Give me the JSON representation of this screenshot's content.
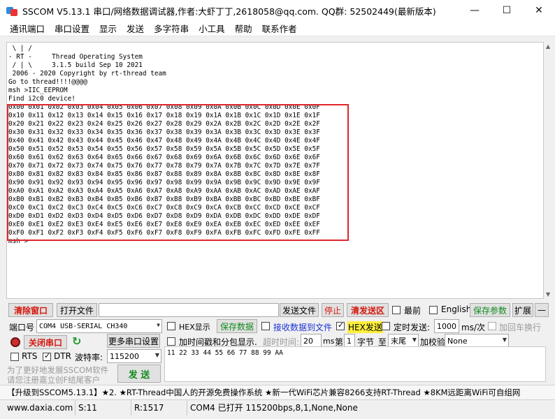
{
  "window": {
    "title": "SSCOM V5.13.1 串口/网络数据调试器,作者:大虾丁丁,2618058@qq.com. QQ群: 52502449(最新版本)",
    "controls": {
      "minimize": "—",
      "maximize": "☐",
      "close": "✕"
    }
  },
  "menu": [
    "通讯端口",
    "串口设置",
    "显示",
    "发送",
    "多字符串",
    "小工具",
    "帮助",
    "联系作者"
  ],
  "terminal": {
    "lines": [
      " \\ | /",
      "- RT -     Thread Operating System",
      " / | \\     3.1.5 build Sep 10 2021",
      " 2006 - 2020 Copyright by rt-thread team",
      "Go to thread!!!!@@@@",
      "msh >IIC_EEPROM",
      "Find i2c0 device!",
      "0x00 0x01 0x02 0x03 0x04 0x05 0x06 0x07 0x08 0x09 0x0A 0x0B 0x0C 0x0D 0x0E 0x0F",
      "0x10 0x11 0x12 0x13 0x14 0x15 0x16 0x17 0x18 0x19 0x1A 0x1B 0x1C 0x1D 0x1E 0x1F",
      "0x20 0x21 0x22 0x23 0x24 0x25 0x26 0x27 0x28 0x29 0x2A 0x2B 0x2C 0x2D 0x2E 0x2F",
      "0x30 0x31 0x32 0x33 0x34 0x35 0x36 0x37 0x38 0x39 0x3A 0x3B 0x3C 0x3D 0x3E 0x3F",
      "0x40 0x41 0x42 0x43 0x44 0x45 0x46 0x47 0x48 0x49 0x4A 0x4B 0x4C 0x4D 0x4E 0x4F",
      "0x50 0x51 0x52 0x53 0x54 0x55 0x56 0x57 0x58 0x59 0x5A 0x5B 0x5C 0x5D 0x5E 0x5F",
      "0x60 0x61 0x62 0x63 0x64 0x65 0x66 0x67 0x68 0x69 0x6A 0x6B 0x6C 0x6D 0x6E 0x6F",
      "0x70 0x71 0x72 0x73 0x74 0x75 0x76 0x77 0x78 0x79 0x7A 0x7B 0x7C 0x7D 0x7E 0x7F",
      "0x80 0x81 0x82 0x83 0x84 0x85 0x86 0x87 0x88 0x89 0x8A 0x8B 0x8C 0x8D 0x8E 0x8F",
      "0x90 0x91 0x92 0x93 0x94 0x95 0x96 0x97 0x98 0x99 0x9A 0x9B 0x9C 0x9D 0x9E 0x9F",
      "0xA0 0xA1 0xA2 0xA3 0xA4 0xA5 0xA6 0xA7 0xA8 0xA9 0xAA 0xAB 0xAC 0xAD 0xAE 0xAF",
      "0xB0 0xB1 0xB2 0xB3 0xB4 0xB5 0xB6 0xB7 0xB8 0xB9 0xBA 0xBB 0xBC 0xBD 0xBE 0xBF",
      "0xC0 0xC1 0xC2 0xC3 0xC4 0xC5 0xC6 0xC7 0xC8 0xC9 0xCA 0xCB 0xCC 0xCD 0xCE 0xCF",
      "0xD0 0xD1 0xD2 0xD3 0xD4 0xD5 0xD6 0xD7 0xD8 0xD9 0xDA 0xDB 0xDC 0xDD 0xDE 0xDF",
      "0xE0 0xE1 0xE2 0xE3 0xE4 0xE5 0xE6 0xE7 0xE8 0xE9 0xEA 0xEB 0xEC 0xED 0xEE 0xEF",
      "0xF0 0xF1 0xF2 0xF3 0xF4 0xF5 0xF6 0xF7 0xF8 0xF9 0xFA 0xFB 0xFC 0xFD 0xFE 0xFF",
      "msh >"
    ],
    "highlight_color": "#e0252b"
  },
  "row1": {
    "clear": "清除窗口",
    "open_file": "打开文件",
    "send_file": "发送文件",
    "stop": "停止",
    "clear_send": "清发送区",
    "topmost": "最前",
    "english": "English",
    "save_params": "保存参数",
    "expand": "扩展",
    "collapse": "—"
  },
  "row2": {
    "port_label": "端口号",
    "port_value": "COM4 USB-SERIAL CH340",
    "hex_display": "HEX显示",
    "save_data": "保存数据",
    "recv_to_file": "接收数据到文件",
    "hex_send": "HEX发送",
    "timed_send": "定时发送:",
    "interval": "1000",
    "interval_unit": "ms/次",
    "add_cr": "加回车换行"
  },
  "row3": {
    "close_port": "关闭串口",
    "more_settings": "更多串口设置",
    "timestamp": "加时间戳和分包显示.",
    "timeout_label": "超时时间:",
    "timeout_value": "20",
    "timeout_unit": "ms",
    "nth": "第",
    "byte_start": "1",
    "byte_label": "字节",
    "to": "至",
    "end_value": "末尾",
    "checksum_label": "加校验",
    "checksum_value": "None"
  },
  "row4": {
    "rts": "RTS",
    "dtr": "DTR",
    "baud_label": "波特率:",
    "baud_value": "115200"
  },
  "send": {
    "promo_line1": "为了更好地发展SSCOM软件",
    "promo_line2": "请您注册嘉立创F结尾客户",
    "send_button": "发 送",
    "text": "11 22 33 44 55 66 77 88 99 AA"
  },
  "ticker": "【升级到SSCOM5.13.1】★2. ★RT-Thread中国人的开源免费操作系统 ★新一代WiFi芯片兼容8266支持RT-Thread ★8KM远距离WiFi可自组网",
  "status": {
    "website": "www.daxia.com",
    "sent": "S:11",
    "received": "R:1517",
    "port_state": "COM4 已打开  115200bps,8,1,None,None"
  }
}
